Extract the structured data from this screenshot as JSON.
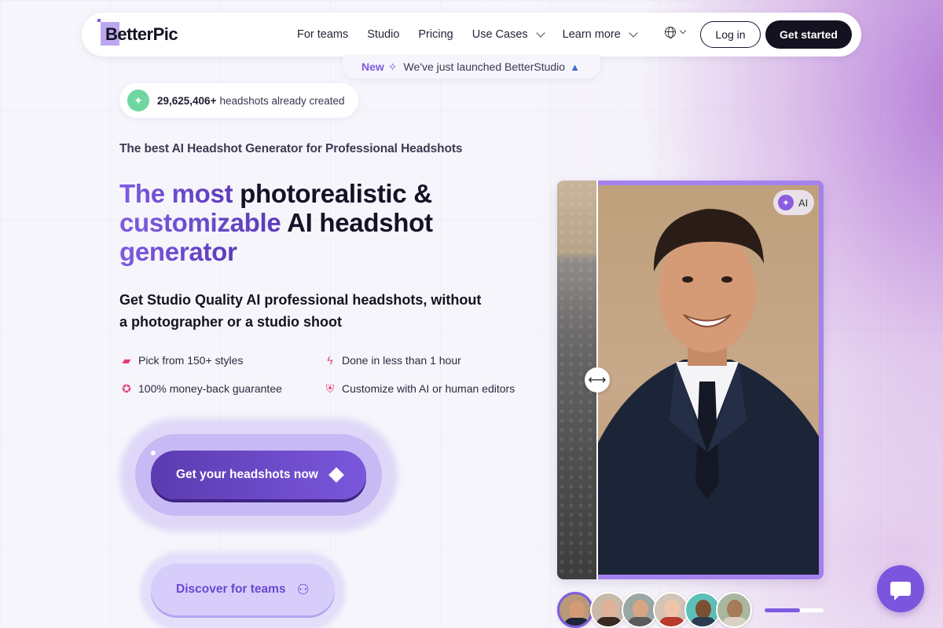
{
  "brand": {
    "name": "BetterPic"
  },
  "nav": {
    "links": [
      {
        "label": "For teams",
        "dropdown": false
      },
      {
        "label": "Studio",
        "dropdown": false
      },
      {
        "label": "Pricing",
        "dropdown": false
      },
      {
        "label": "Use Cases",
        "dropdown": true
      },
      {
        "label": "Learn more",
        "dropdown": true
      }
    ],
    "language_icon": "globe-icon",
    "login_label": "Log in",
    "get_started_label": "Get started"
  },
  "announcement": {
    "badge": "New",
    "text": "We've just launched BetterStudio"
  },
  "counter": {
    "count": "29,625,406+",
    "text": "headshots already created"
  },
  "hero": {
    "kicker": "The best AI Headshot Generator for Professional Headshots",
    "headline_highlight_1": "The most",
    "headline_plain_1": " photorealistic &",
    "headline_highlight_2": "customizable",
    "headline_plain_2": " AI headshot",
    "headline_highlight_3": "generator",
    "subheading": "Get Studio Quality AI professional headshots, without a photographer or a studio shoot",
    "features": [
      {
        "icon": "palette-icon",
        "label": "Pick from 150+ styles"
      },
      {
        "icon": "lightning-icon",
        "label": "Done in less than 1 hour"
      },
      {
        "icon": "ribbon-icon",
        "label": "100% money-back guarantee"
      },
      {
        "icon": "shield-check-icon",
        "label": "Customize with AI or human editors"
      }
    ],
    "cta_primary": "Get your headshots now",
    "cta_secondary": "Discover for teams"
  },
  "compare": {
    "ai_badge": "AI",
    "active_thumbnail": 0,
    "thumbnail_count": 6,
    "carousel_progress": 0.6
  },
  "colors": {
    "accent": "#7d5ce0",
    "dark": "#141221",
    "cta_gradient_start": "#5b3bb0",
    "cta_gradient_end": "#7a57dc",
    "feature_icon": "#e0407a"
  }
}
